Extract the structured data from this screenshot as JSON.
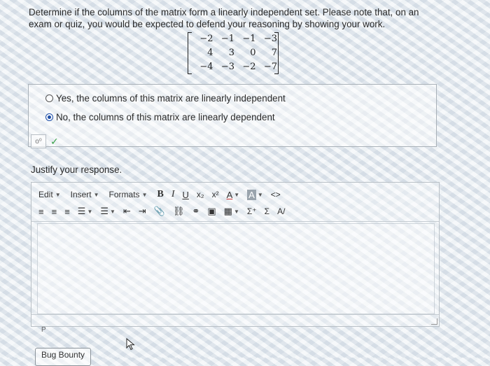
{
  "question": {
    "text": "Determine if the columns of the matrix form a linearly independent set. Please note that, on an exam or quiz, you would be expected to defend your reasoning by showing your work."
  },
  "matrix": {
    "rows": [
      [
        "−2",
        "−1",
        "−1",
        "−3"
      ],
      [
        "4",
        "3",
        "0",
        "7"
      ],
      [
        "−4",
        "−3",
        "−2",
        "−7"
      ]
    ]
  },
  "options": [
    {
      "label": "Yes, the columns of this matrix are linearly independent",
      "selected": false
    },
    {
      "label": "No, the columns of this matrix are linearly dependent",
      "selected": true
    }
  ],
  "feedback": {
    "key_icon": "key-icon",
    "check_icon": "check-icon",
    "key_glyph": "o⁰",
    "check_glyph": "✓"
  },
  "justify": {
    "label": "Justify your response."
  },
  "editor": {
    "menus": [
      "Edit",
      "Insert",
      "Formats"
    ],
    "format_buttons": [
      "B",
      "I",
      "U",
      "x₂",
      "x²",
      "A",
      "A",
      "<>"
    ],
    "row2_glyphs": [
      "≡",
      "≡",
      "≡",
      "☰",
      "☰",
      "⇤",
      "⇥",
      "📎",
      "⛓",
      "⚭",
      "▣",
      "▦",
      "Σ⁺",
      "Σ",
      "A/"
    ],
    "status_text": "P"
  },
  "footer": {
    "bug_bounty_label": "Bug Bounty"
  }
}
